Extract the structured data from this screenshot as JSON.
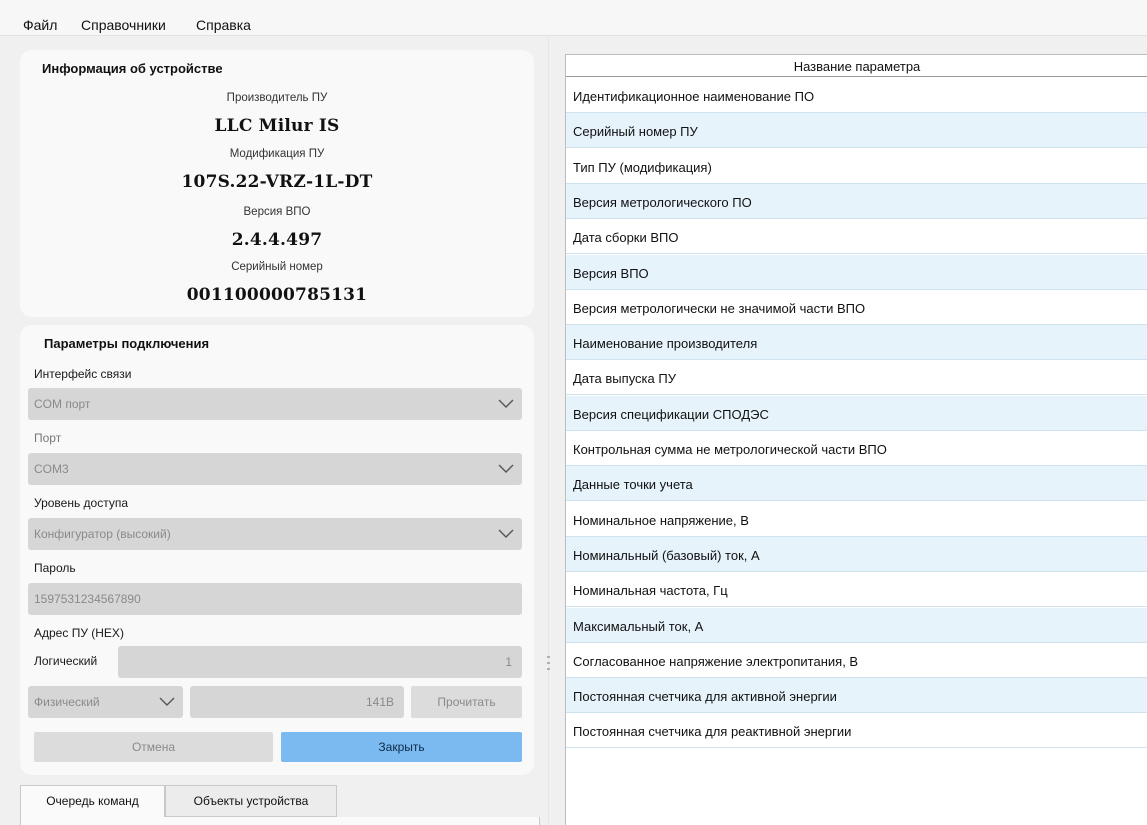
{
  "menu": [
    "Файл",
    "Справочники",
    "Справка"
  ],
  "device_info": {
    "title": "Информация об устройстве",
    "manufacturer_label": "Производитель ПУ",
    "manufacturer_value": "LLC Milur IS",
    "modification_label": "Модификация ПУ",
    "modification_value": "107S.22-VRZ-1L-DT",
    "firmware_label": "Версия ВПО",
    "firmware_value": "2.4.4.497",
    "serial_label": "Серийный номер",
    "serial_value": "001100000785131"
  },
  "connection": {
    "title": "Параметры подключения",
    "interface_label": "Интерфейс связи",
    "interface_value": "COM порт",
    "port_label": "Порт",
    "port_value": "COM3",
    "access_label": "Уровень доступа",
    "access_value": "Конфигуратор (высокий)",
    "password_label": "Пароль",
    "password_value": "1597531234567890",
    "address_label": "Адрес ПУ (HEX)",
    "logical_label": "Логический",
    "logical_value": "1",
    "physical_select": "Физический",
    "physical_value": "141B",
    "read_button": "Прочитать",
    "cancel_button": "Отмена",
    "close_button": "Закрыть"
  },
  "tabs": [
    "Очередь команд",
    "Объекты устройства"
  ],
  "table": {
    "header": "Название параметра",
    "rows": [
      "Идентификационное наименование ПО",
      "Серийный номер ПУ",
      "Тип ПУ (модификация)",
      "Версия метрологического ПО",
      "Дата сборки ВПО",
      "Версия ВПО",
      "Версия метрологически не значимой части ВПО",
      "Наименование производителя",
      "Дата выпуска ПУ",
      "Версия спецификации СПОДЭС",
      "Контрольная сумма не метрологической части ВПО",
      "Данные точки учета",
      "Номинальное напряжение, В",
      "Номинальный (базовый) ток, А",
      "Номинальная частота, Гц",
      "Максимальный ток, А",
      "Согласованное напряжение электропитания, В",
      "Постоянная счетчика для активной энергии",
      "Постоянная счетчика для реактивной энергии"
    ]
  },
  "colors": {
    "accent_button": "#7bbaf0",
    "row_alt": "#e6f3fb",
    "field_disabled": "#d6d6d6"
  }
}
